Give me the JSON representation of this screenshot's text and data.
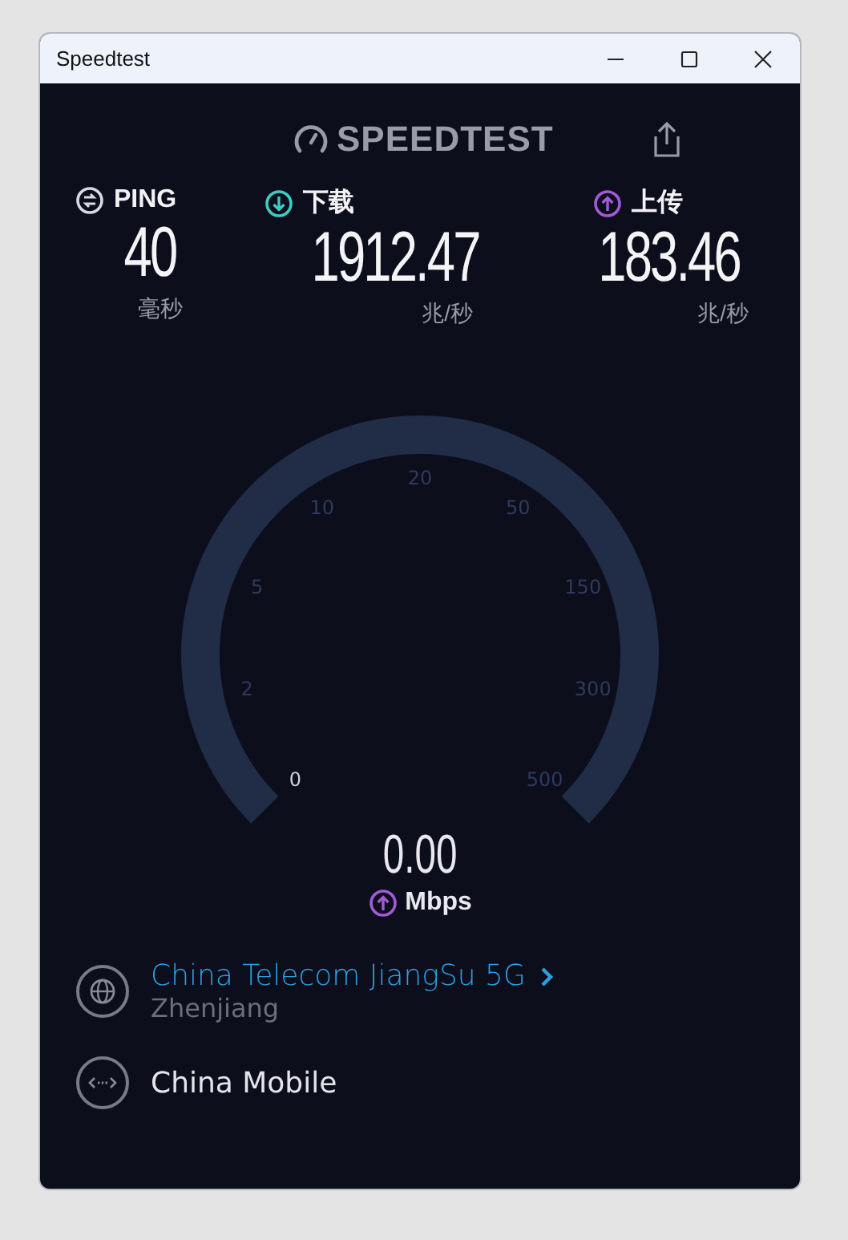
{
  "window": {
    "title": "Speedtest"
  },
  "logo": {
    "text": "SPEEDTEST"
  },
  "stats": [
    {
      "kind": "ping",
      "label": "PING",
      "value": "40",
      "unit": "毫秒"
    },
    {
      "kind": "download",
      "label": "下载",
      "value": "1912.47",
      "unit": "兆/秒"
    },
    {
      "kind": "upload",
      "label": "上传",
      "value": "183.46",
      "unit": "兆/秒"
    }
  ],
  "gauge": {
    "ticks": [
      {
        "label": "0",
        "selected": true
      },
      {
        "label": "2",
        "selected": false
      },
      {
        "label": "5",
        "selected": false
      },
      {
        "label": "10",
        "selected": false
      },
      {
        "label": "20",
        "selected": false
      },
      {
        "label": "50",
        "selected": false
      },
      {
        "label": "150",
        "selected": false
      },
      {
        "label": "300",
        "selected": false
      },
      {
        "label": "500",
        "selected": false
      }
    ],
    "reading": "0.00",
    "unit": "Mbps"
  },
  "servers": [
    {
      "kind": "server",
      "name": "China Telecom JiangSu 5G",
      "location": "Zhenjiang"
    },
    {
      "kind": "provider",
      "name": "China Mobile"
    }
  ]
}
